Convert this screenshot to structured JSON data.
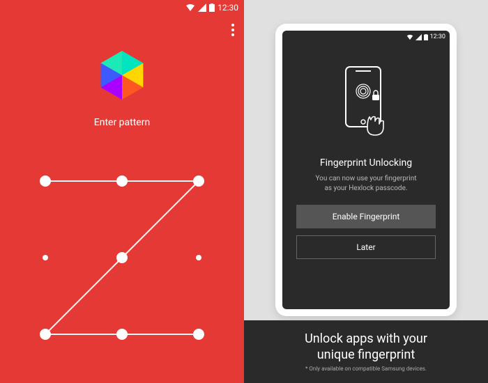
{
  "status": {
    "time": "12:30"
  },
  "left": {
    "prompt": "Enter pattern",
    "pattern": {
      "grid": 3,
      "path": [
        0,
        1,
        2,
        4,
        6,
        7,
        8
      ]
    }
  },
  "right": {
    "tablet": {
      "title": "Fingerprint Unlocking",
      "subtitle_line1": "You can now use your fingerprint",
      "subtitle_line2": "as your Hexlock passcode.",
      "primary_button": "Enable Fingerprint",
      "secondary_button": "Later"
    },
    "banner": {
      "heading_line1": "Unlock apps with your",
      "heading_line2": "unique fingerprint",
      "footnote": "* Only available on compatible Samsung devices."
    }
  }
}
